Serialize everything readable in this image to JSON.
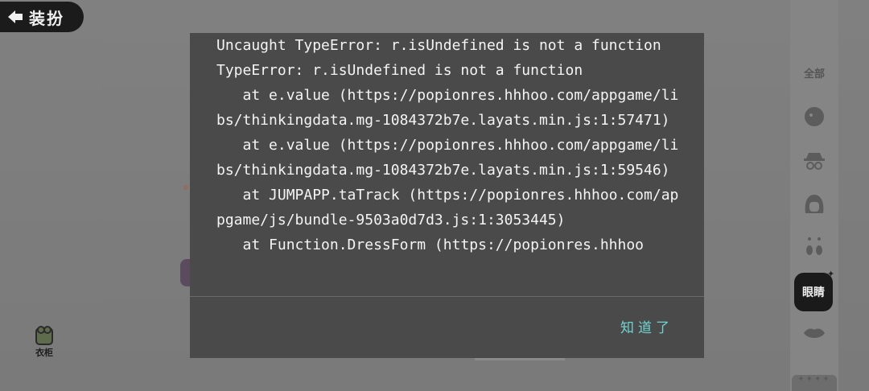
{
  "header": {
    "back_label": "装扮"
  },
  "wardrobe": {
    "label": "衣柜"
  },
  "sidebar": {
    "all_label": "全部",
    "items": [
      {
        "icon": "face-icon"
      },
      {
        "icon": "hat-disguise-icon"
      },
      {
        "icon": "hair-icon"
      },
      {
        "icon": "earring-icon"
      },
      {
        "label": "眼睛",
        "selected": true
      },
      {
        "icon": "lips-icon"
      }
    ],
    "bottom_decor": "✦✦✦✦"
  },
  "dialog": {
    "error_text": "Uncaught TypeError: r.isUndefined is not a function\nTypeError: r.isUndefined is not a function\n   at e.value (https://popionres.hhhoo.com/appgame/libs/thinkingdata.mg-1084372b7e.layats.min.js:1:57471)\n   at e.value (https://popionres.hhhoo.com/appgame/libs/thinkingdata.mg-1084372b7e.layats.min.js:1:59546)\n   at JUMPAPP.taTrack (https://popionres.hhhoo.com/appgame/js/bundle-9503a0d7d3.js:1:3053445)\n   at Function.DressForm (https://popionres.hhhoo",
    "ok_label": "知道了"
  },
  "colors": {
    "dialog_bg": "#4a4a4a",
    "ok_text": "#6fd4cf",
    "overlay": "#7b7b7b"
  }
}
